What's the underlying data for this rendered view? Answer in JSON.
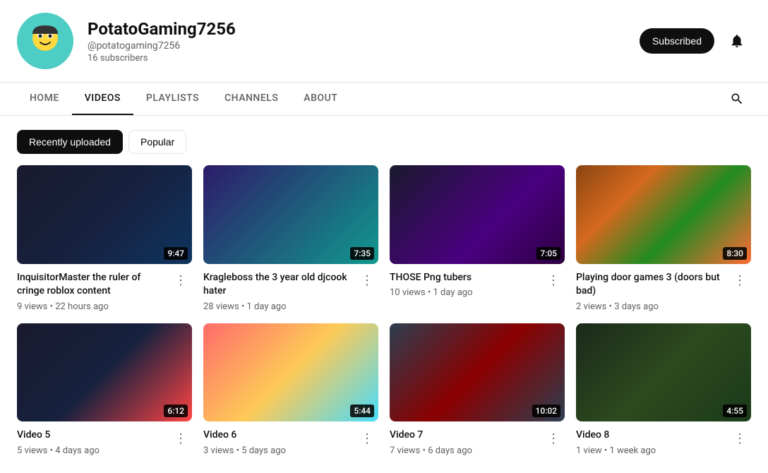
{
  "channel": {
    "name": "PotatoGaming7256",
    "handle": "@potatogaming7256",
    "subscribers": "16 subscribers",
    "subscribe_label": "Subscribed",
    "bell_icon": "bell"
  },
  "nav": {
    "tabs": [
      {
        "id": "home",
        "label": "HOME",
        "active": false
      },
      {
        "id": "videos",
        "label": "VIDEOS",
        "active": true
      },
      {
        "id": "playlists",
        "label": "PLAYLISTS",
        "active": false
      },
      {
        "id": "channels",
        "label": "CHANNELS",
        "active": false
      },
      {
        "id": "about",
        "label": "ABOUT",
        "active": false
      }
    ],
    "search_icon": "search"
  },
  "filters": [
    {
      "id": "recently-uploaded",
      "label": "Recently uploaded",
      "active": true
    },
    {
      "id": "popular",
      "label": "Popular",
      "active": false
    }
  ],
  "videos": [
    {
      "id": 1,
      "title": "InquisitorMaster the ruler of cringe roblox content",
      "views": "9 views",
      "ago": "22 hours ago",
      "duration": "9:47",
      "thumb_class": "thumb-1"
    },
    {
      "id": 2,
      "title": "Kragleboss the 3 year old djcook hater",
      "views": "28 views",
      "ago": "1 day ago",
      "duration": "7:35",
      "thumb_class": "thumb-2"
    },
    {
      "id": 3,
      "title": "THOSE Png tubers",
      "views": "10 views",
      "ago": "1 day ago",
      "duration": "7:05",
      "thumb_class": "thumb-3"
    },
    {
      "id": 4,
      "title": "Playing door games 3 (doors but bad)",
      "views": "2 views",
      "ago": "3 days ago",
      "duration": "8:30",
      "thumb_class": "thumb-4"
    },
    {
      "id": 5,
      "title": "Video 5",
      "views": "5 views",
      "ago": "4 days ago",
      "duration": "6:12",
      "thumb_class": "thumb-5"
    },
    {
      "id": 6,
      "title": "Video 6",
      "views": "3 views",
      "ago": "5 days ago",
      "duration": "5:44",
      "thumb_class": "thumb-6"
    },
    {
      "id": 7,
      "title": "Video 7",
      "views": "7 views",
      "ago": "6 days ago",
      "duration": "10:02",
      "thumb_class": "thumb-7"
    },
    {
      "id": 8,
      "title": "Video 8",
      "views": "1 view",
      "ago": "1 week ago",
      "duration": "4:55",
      "thumb_class": "thumb-8"
    }
  ]
}
